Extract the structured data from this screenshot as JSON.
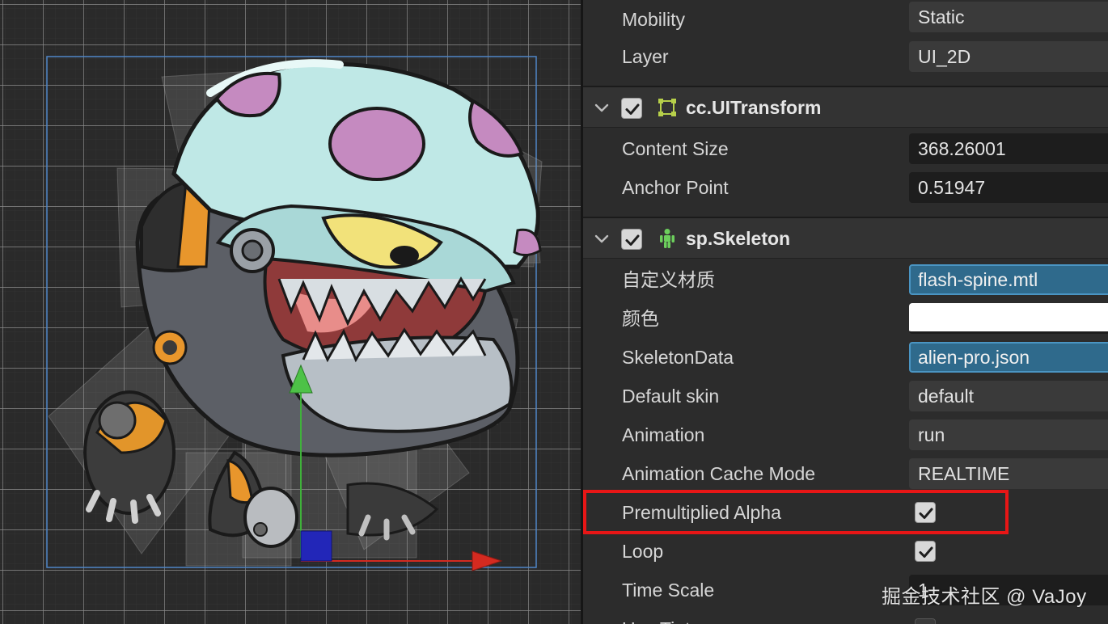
{
  "inspector": {
    "node_rows": [
      {
        "label": "Mobility",
        "value": "Static"
      },
      {
        "label": "Layer",
        "value": "UI_2D"
      }
    ],
    "ui_transform": {
      "title": "cc.UITransform",
      "enabled": true,
      "icon": "rect-transform-icon",
      "rows": [
        {
          "label": "Content Size",
          "value": "368.26001"
        },
        {
          "label": "Anchor Point",
          "value": "0.51947"
        }
      ]
    },
    "skeleton": {
      "title": "sp.Skeleton",
      "enabled": true,
      "icon": "skeleton-figure-icon",
      "custom_material": {
        "label": "自定义材质",
        "value": "flash-spine.mtl"
      },
      "color": {
        "label": "颜色",
        "value": "#ffffff"
      },
      "skeleton_data": {
        "label": "SkeletonData",
        "value": "alien-pro.json"
      },
      "default_skin": {
        "label": "Default skin",
        "value": "default"
      },
      "animation": {
        "label": "Animation",
        "value": "run"
      },
      "cache_mode": {
        "label": "Animation Cache Mode",
        "value": "REALTIME"
      },
      "premultiplied_alpha": {
        "label": "Premultiplied Alpha",
        "checked": true
      },
      "loop": {
        "label": "Loop",
        "checked": true
      },
      "time_scale": {
        "label": "Time Scale",
        "value": "1"
      },
      "use_tint": {
        "label": "Use Tint",
        "checked": false
      }
    }
  },
  "watermark": "掘金技术社区 @ VaJoy",
  "colors": {
    "highlight": "#e81616",
    "asset_field": "#2f6a8c",
    "gizmo_x": "#d42a20",
    "gizmo_y": "#3fb23a",
    "gizmo_z": "#2226b8",
    "helmet": "#bfe8e6",
    "spots": "#c58ac0"
  }
}
